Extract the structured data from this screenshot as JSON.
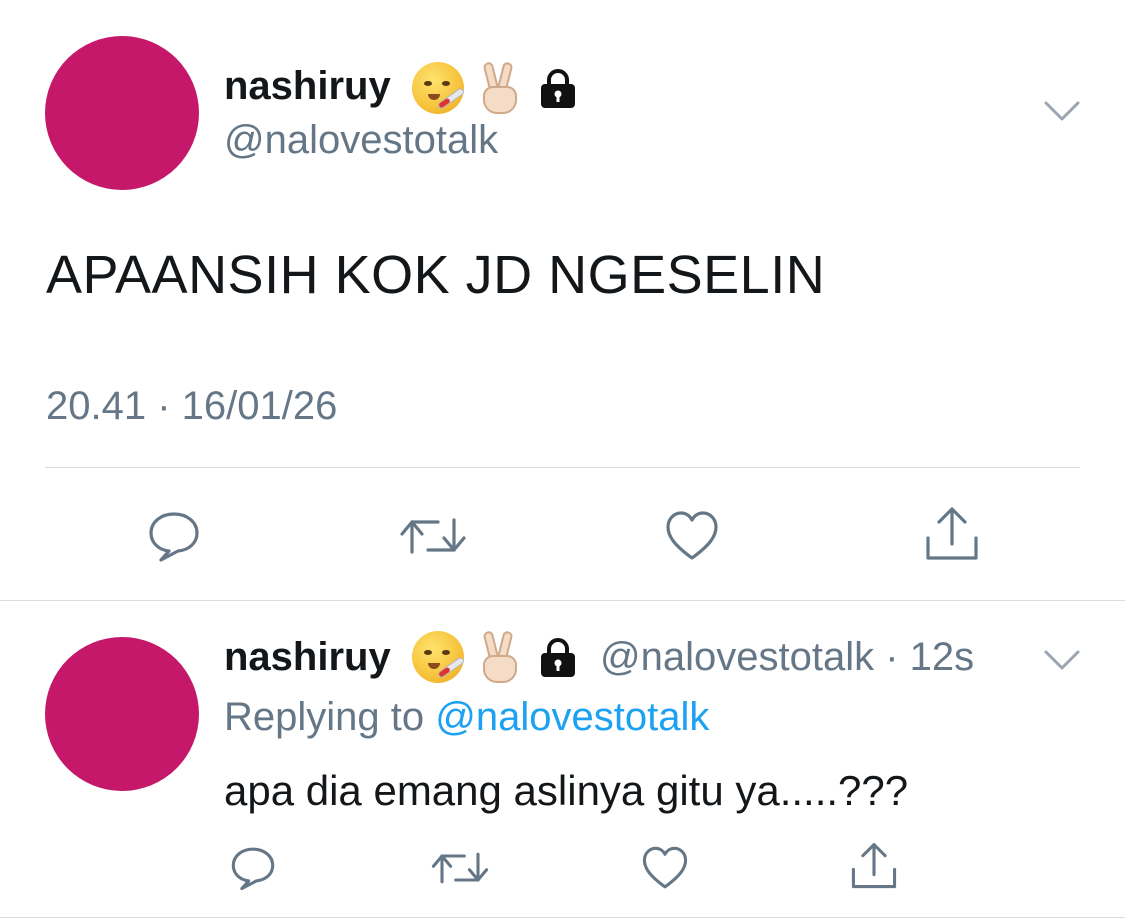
{
  "colors": {
    "avatar": "#c5186a",
    "secondary_text": "#657786",
    "link": "#1da1f2",
    "divider": "#d8dde1"
  },
  "main_tweet": {
    "display_name": "nashiruy",
    "badges": [
      "face-with-thermometer-emoji",
      "victory-hand-emoji",
      "lock-icon"
    ],
    "handle": "@nalovestotalk",
    "text": "APAANSIH KOK JD NGESELIN",
    "timestamp": "20.41 · 16/01/26",
    "actions": [
      "reply-icon",
      "retweet-icon",
      "like-icon",
      "share-icon"
    ]
  },
  "reply_tweet": {
    "display_name": "nashiruy",
    "badges": [
      "face-with-thermometer-emoji",
      "victory-hand-emoji",
      "lock-icon"
    ],
    "handle_time": "@nalovestotalk · 12s",
    "replying_prefix": "Replying to",
    "replying_handle": "@nalovestotalk",
    "text": "apa dia emang aslinya gitu ya.....???",
    "actions": [
      "reply-icon",
      "retweet-icon",
      "like-icon",
      "share-icon"
    ]
  }
}
